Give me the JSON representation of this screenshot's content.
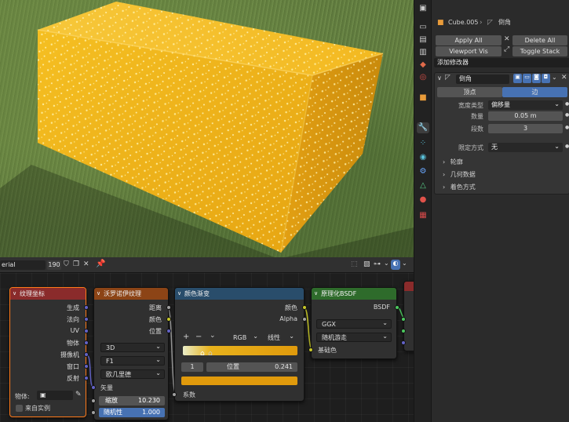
{
  "properties": {
    "breadcrumb": {
      "object": "Cube.005",
      "modifier": "倒角"
    },
    "buttons": {
      "apply_all": "Apply All",
      "delete_all": "Delete All",
      "viewport_vis": "Viewport Vis",
      "toggle_stack": "Toggle Stack"
    },
    "add_modifier": "添加修改器",
    "modifier": {
      "name": "倒角",
      "tabs": [
        "顶点",
        "边"
      ],
      "active_tab": "边",
      "width_type_label": "宽度类型",
      "width_type_value": "偏移量",
      "amount_label": "数量",
      "amount_value": "0.05 m",
      "segments_label": "段数",
      "segments_value": "3",
      "limit_label": "限定方式",
      "limit_value": "无",
      "sections": [
        "轮廓",
        "几何数据",
        "着色方式"
      ]
    }
  },
  "node_editor": {
    "header": {
      "material_name": "erial",
      "user_count": "190"
    },
    "nodes": {
      "texcoord": {
        "title": "纹理坐标",
        "outputs": [
          "生成",
          "法向",
          "UV",
          "物体",
          "摄像机",
          "窗口",
          "反射"
        ],
        "object_label": "物体:",
        "from_instancer": "来自实例"
      },
      "voronoi": {
        "title": "沃罗诺伊纹理",
        "outputs": [
          "距离",
          "颜色",
          "位置"
        ],
        "dimension": "3D",
        "feature": "F1",
        "metric": "欧几里德",
        "input_vector": "矢量",
        "scale_label": "缩放",
        "scale_value": "10.230",
        "randomness_label": "随机性",
        "randomness_value": "1.000"
      },
      "colorramp": {
        "title": "颜色渐变",
        "outputs": [
          "颜色",
          "Alpha"
        ],
        "mode": "RGB",
        "interp": "线性",
        "index": "1",
        "pos_label": "位置",
        "pos_value": "0.241",
        "input_fac": "系数"
      },
      "bsdf": {
        "title": "原理化BSDF",
        "output": "BSDF",
        "distribution": "GGX",
        "subsurface": "随机游走",
        "input_base": "基础色"
      }
    }
  },
  "colors": {
    "cube_color": "#f2b418",
    "dot_color": "#fff4b0",
    "texcoord_header": "#8a2b2b",
    "voronoi_header": "#8c4416",
    "colorramp_header": "#294d6b",
    "bsdf_header": "#2e6b2b",
    "accent_blue": "#4772b3"
  }
}
